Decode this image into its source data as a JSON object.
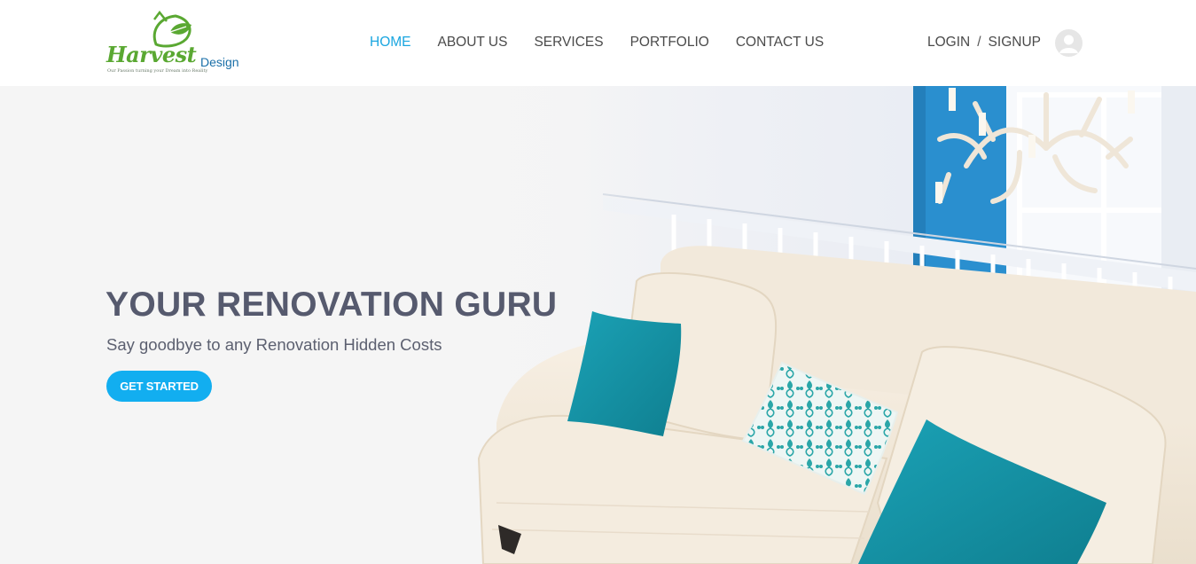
{
  "brand": {
    "word": "Harvest",
    "suffix": "Design",
    "tagline": "Our Passion turning your Dream into Reality"
  },
  "nav": {
    "items": [
      {
        "label": "HOME",
        "active": true
      },
      {
        "label": "ABOUT US",
        "active": false
      },
      {
        "label": "SERVICES",
        "active": false
      },
      {
        "label": "PORTFOLIO",
        "active": false
      },
      {
        "label": "CONTACT US",
        "active": false
      }
    ]
  },
  "auth": {
    "login": "LOGIN",
    "separator": "/",
    "signup": "SIGNUP",
    "avatar_icon": "user-avatar-icon"
  },
  "hero": {
    "title": "YOUR RENOVATION GURU",
    "subtitle": "Say goodbye to any Renovation Hidden Costs",
    "cta": "GET STARTED"
  },
  "colors": {
    "accent": "#1aa6e0",
    "button": "#12aef0",
    "brand_green": "#5aa832",
    "brand_blue": "#1a6fa8",
    "heading": "#565a6e",
    "hero_bg": "#f5f5f5"
  }
}
